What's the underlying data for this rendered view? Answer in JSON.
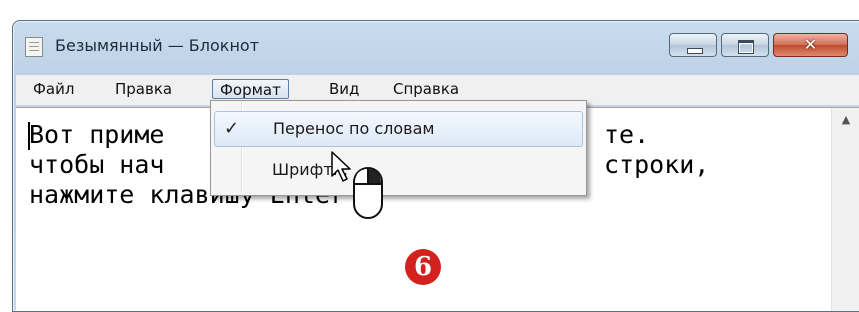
{
  "window": {
    "title": "Безымянный — Блокнот"
  },
  "controls": {
    "close_glyph": "✕"
  },
  "menu": {
    "items": [
      "Файл",
      "Правка",
      "Формат",
      "Вид",
      "Справка"
    ]
  },
  "format_menu": {
    "items": [
      {
        "label": "Перенос по словам",
        "checked": true,
        "check_glyph": "✓"
      },
      {
        "label": "Шрифт...",
        "checked": false
      }
    ]
  },
  "document": {
    "lines": [
      "Вот приме",
      "чтобы нач",
      "нажмите клавишу Enter"
    ],
    "line1_end": "те.",
    "line2_end": "строки,"
  },
  "scrollbar": {
    "up_arrow": "▲"
  },
  "step_badge": "6",
  "colors": {
    "badge": "#d3211d",
    "menu_highlight": "#dde9f6"
  }
}
